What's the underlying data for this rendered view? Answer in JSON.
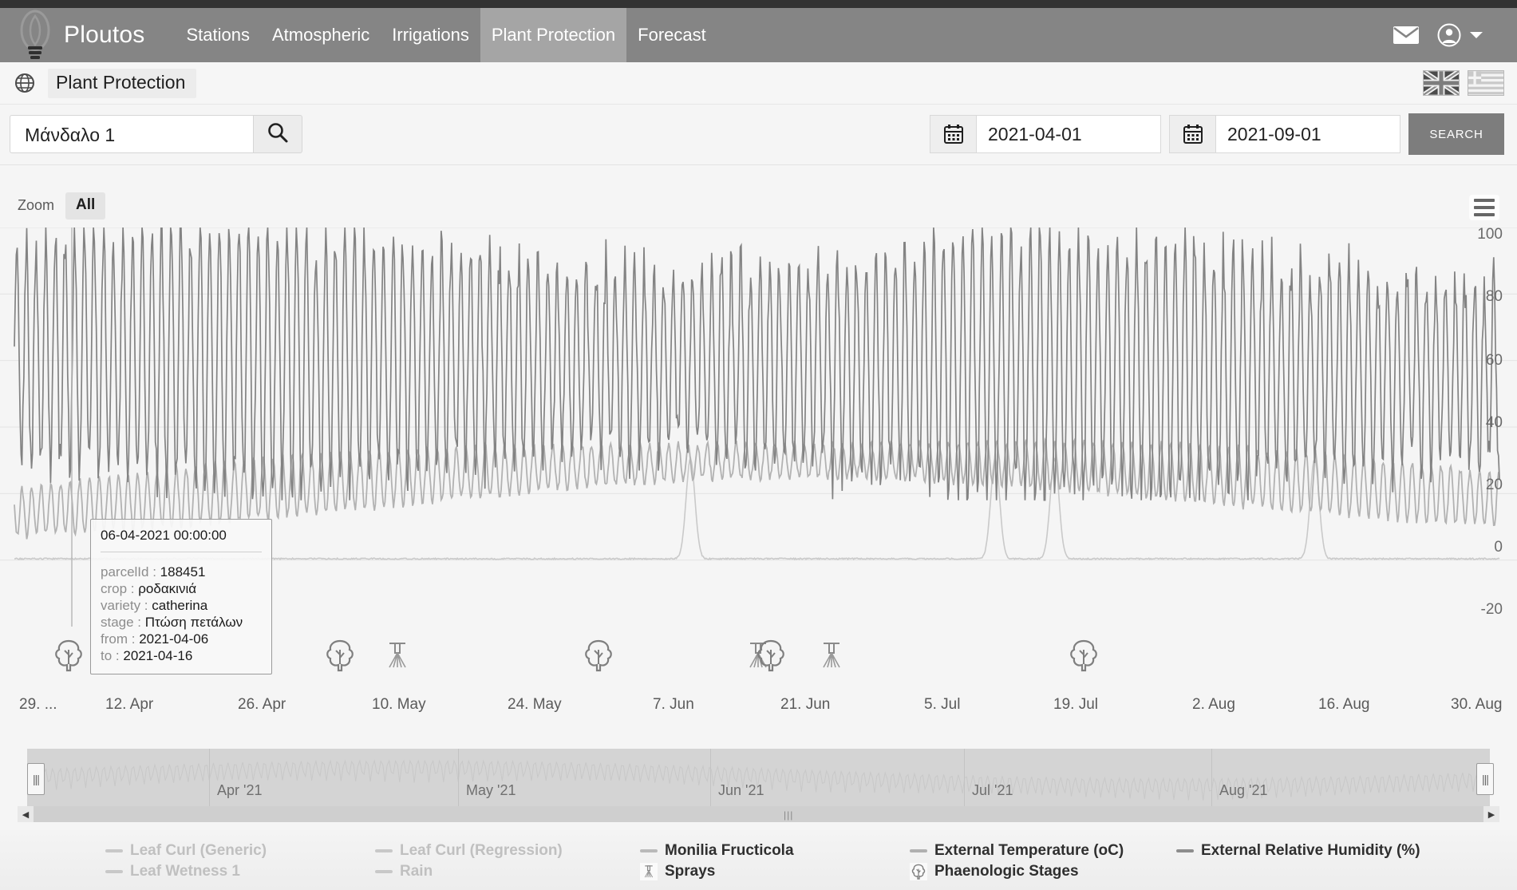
{
  "navbar": {
    "brand": "Ploutos",
    "logo_icon": "leaf-logo-icon",
    "links": [
      {
        "label": "Stations",
        "active": false
      },
      {
        "label": "Atmospheric",
        "active": false
      },
      {
        "label": "Irrigations",
        "active": false
      },
      {
        "label": "Plant Protection",
        "active": true
      },
      {
        "label": "Forecast",
        "active": false
      }
    ],
    "mail_icon": "mail-icon",
    "account_icon": "account-circle-icon",
    "caret_icon": "chevron-down-icon"
  },
  "subheader": {
    "globe_icon": "globe-icon",
    "title": "Plant Protection",
    "flag_en": "uk-flag-icon",
    "flag_el": "greece-flag-icon"
  },
  "search": {
    "station_value": "Μάνδαλο 1",
    "station_placeholder": "Μάνδαλο 1",
    "search_icon": "magnifier-icon",
    "calendar_icon": "calendar-icon",
    "date_from": "2021-04-01",
    "date_to": "2021-09-01",
    "search_button": "SEARCH"
  },
  "chart_controls": {
    "zoom_label": "Zoom",
    "zoom_all": "All",
    "menu_icon": "hamburger-menu-icon"
  },
  "tooltip": {
    "title": "06-04-2021 00:00:00",
    "rows": [
      {
        "key": "parcelId :",
        "value": "188451"
      },
      {
        "key": "crop :",
        "value": "ροδακινιά"
      },
      {
        "key": "variety :",
        "value": "catherina"
      },
      {
        "key": "stage :",
        "value": "Πτώση πετάλων"
      },
      {
        "key": "from :",
        "value": "2021-04-06"
      },
      {
        "key": "to :",
        "value": "2021-04-16"
      }
    ]
  },
  "navigator": {
    "month_labels": [
      "Apr '21",
      "May '21",
      "Jun '21",
      "Jul '21",
      "Aug '21"
    ],
    "left_handle_icon": "navigator-left-handle",
    "right_handle_icon": "navigator-right-handle",
    "scroll_left_icon": "scroll-left-arrow",
    "scroll_right_icon": "scroll-right-arrow"
  },
  "legend": {
    "items": [
      {
        "label": "Leaf Curl (Generic)",
        "symbol": "line",
        "color": "#c8c8c8",
        "enabled": false
      },
      {
        "label": "Leaf Curl (Regression)",
        "symbol": "line",
        "color": "#c8c8c8",
        "enabled": false
      },
      {
        "label": "Monilia Fructicola",
        "symbol": "line",
        "color": "#b4b4b4",
        "enabled": true
      },
      {
        "label": "External Temperature (oC)",
        "symbol": "line",
        "color": "#b0b0b0",
        "enabled": true
      },
      {
        "label": "External Relative Humidity (%)",
        "symbol": "line",
        "color": "#8d8d8d",
        "enabled": true
      },
      {
        "label": "Leaf Wetness 1",
        "symbol": "line",
        "color": "#c8c8c8",
        "enabled": false
      },
      {
        "label": "Rain",
        "symbol": "line",
        "color": "#c8c8c8",
        "enabled": false
      },
      {
        "label": "Sprays",
        "symbol": "spray-icon",
        "color": "#8a8a8a",
        "enabled": true
      },
      {
        "label": "Phaenologic Stages",
        "symbol": "tree-icon",
        "color": "#8a8a8a",
        "enabled": true
      }
    ]
  },
  "chart_data": {
    "type": "line",
    "title": "",
    "xlabel": "",
    "ylabel": "",
    "ylim": [
      -20,
      100
    ],
    "grid": true,
    "legend_position": "bottom",
    "y_ticks": [
      "100",
      "80",
      "60",
      "40",
      "20",
      "0",
      "-20"
    ],
    "x_ticks": [
      "29. ...",
      "12. Apr",
      "26. Apr",
      "10. May",
      "24. May",
      "7. Jun",
      "21. Jun",
      "5. Jul",
      "19. Jul",
      "2. Aug",
      "16. Aug",
      "30. Aug"
    ],
    "x_range": [
      "2021-03-29",
      "2021-08-30"
    ],
    "series": [
      {
        "name": "External Relative Humidity (%)",
        "color": "#8d8d8d",
        "unit": "%",
        "approx_range": [
          20,
          100
        ],
        "description": "High-frequency daily oscillation between roughly 25% and 95%, dense across full period"
      },
      {
        "name": "External Temperature (oC)",
        "color": "#b0b0b0",
        "unit": "oC",
        "approx_range": [
          5,
          40
        ],
        "description": "Daily oscillation rising from about 8-20 in April to about 22-38 in July/August"
      },
      {
        "name": "Monilia Fructicola",
        "color": "#c5c5c5",
        "unit": "index",
        "approx_range": [
          0,
          30
        ],
        "description": "Mostly flat near 0 with four narrow spikes reaching about 30 near 7. Jun, 12. Jul, 16. Aug"
      }
    ],
    "markers": [
      {
        "type": "Phaenologic Stages",
        "x": "2021-04-06",
        "icon": "tree-icon"
      },
      {
        "type": "Phaenologic Stages",
        "x": "2021-04-26",
        "icon": "tree-icon"
      },
      {
        "type": "Sprays",
        "x": "2021-05-02",
        "icon": "spray-icon"
      },
      {
        "type": "Phaenologic Stages",
        "x": "2021-05-30",
        "icon": "tree-icon"
      },
      {
        "type": "Sprays",
        "x": "2021-06-28",
        "icon": "spray-icon"
      },
      {
        "type": "Phaenologic Stages",
        "x": "2021-06-30",
        "icon": "tree-icon"
      },
      {
        "type": "Sprays",
        "x": "2021-07-06",
        "icon": "spray-icon"
      },
      {
        "type": "Phaenologic Stages",
        "x": "2021-07-24",
        "icon": "tree-icon"
      }
    ]
  }
}
